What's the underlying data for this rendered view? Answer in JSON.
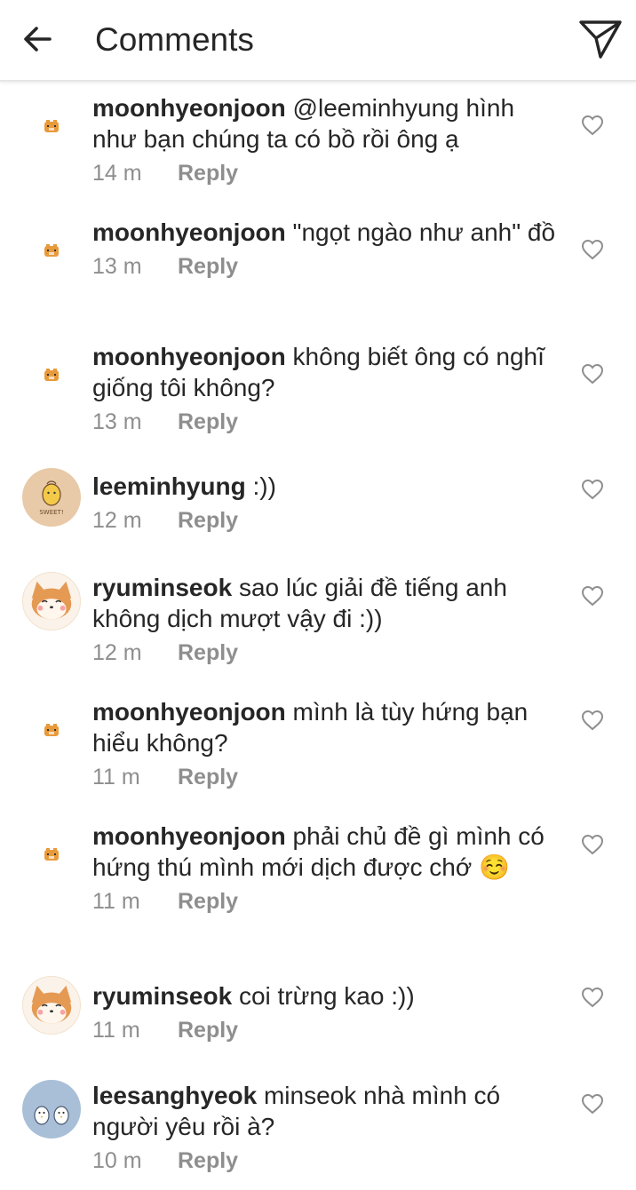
{
  "header": {
    "title": "Comments",
    "back_icon": "arrow-left-icon",
    "send_icon": "paper-plane-icon"
  },
  "labels": {
    "reply": "Reply"
  },
  "comments": [
    {
      "username": "moonhyeonjoon",
      "text": "@leeminhyung hình như bạn chúng ta có bồ rồi ông ạ",
      "time": "14 m",
      "avatar": "tiger"
    },
    {
      "username": "moonhyeonjoon",
      "text": "\"ngọt ngào như anh\" đồ",
      "time": "13 m",
      "avatar": "tiger"
    },
    {
      "username": "moonhyeonjoon",
      "text": "không biết ông có nghĩ giống tôi không?",
      "time": "13 m",
      "avatar": "tiger"
    },
    {
      "username": "leeminhyung",
      "text": ":))",
      "time": "12 m",
      "avatar": "sweet",
      "avatar_text": "SWEET!"
    },
    {
      "username": "ryuminseok",
      "text": "sao lúc giải đề tiếng anh không dịch mượt vậy đi :))",
      "time": "12 m",
      "avatar": "shiba"
    },
    {
      "username": "moonhyeonjoon",
      "text": "mình là tùy hứng bạn hiểu không?",
      "time": "11 m",
      "avatar": "tiger"
    },
    {
      "username": "moonhyeonjoon",
      "text": "phải chủ đề gì mình có hứng thú mình mới dịch được chớ ☺️",
      "time": "11 m",
      "avatar": "tiger"
    },
    {
      "username": "ryuminseok",
      "text": "coi trừng kao :))",
      "time": "11 m",
      "avatar": "shiba"
    },
    {
      "username": "leesanghyeok",
      "text": "minseok nhà mình có người yêu rồi à?",
      "time": "10 m",
      "avatar": "penguin"
    }
  ],
  "colors": {
    "text": "#262626",
    "secondary": "#8e8e8e",
    "divider": "#e6e6e6"
  }
}
